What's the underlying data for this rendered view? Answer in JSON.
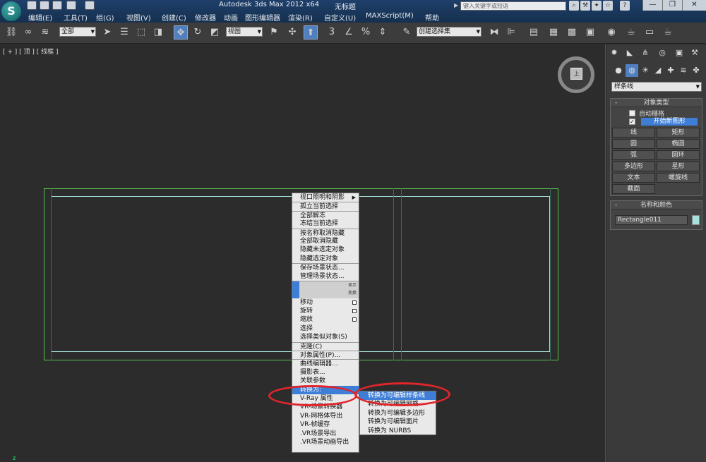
{
  "titlebar": {
    "window_title": "Autodesk 3ds Max  2012 x64",
    "doc_title": "无标题",
    "search_placeholder": "键入关键字或短语"
  },
  "menu": [
    "编辑(E)",
    "工具(T)",
    "组(G)",
    "视图(V)",
    "创建(C)",
    "修改器",
    "动画",
    "图形编辑器",
    "渲染(R)",
    "自定义(U)",
    "MAXScript(M)",
    "帮助"
  ],
  "toolbar": {
    "selection_filter": "全部",
    "ref_coord": "视图",
    "named_selection": "创建选择集"
  },
  "viewport": {
    "label": "[ + ] [ 顶 ] [ 线框 ]",
    "viewcube_face": "上",
    "corner_mark": "z"
  },
  "quad_menu": {
    "left_items": [
      "视口照明和阴影",
      "孤立当前选择",
      "全部解冻",
      "冻结当前选择",
      "按名称取消隐藏",
      "全部取消隐藏",
      "隐藏未选定对象",
      "隐藏选定对象",
      "保存场景状态...",
      "管理场景状态...",
      "显示",
      "变换",
      "移动",
      "旋转",
      "缩放",
      "选择",
      "选择类似对象(S)",
      "克隆(C)",
      "对象属性(P)...",
      "曲线编辑器...",
      "摄影表...",
      "关联参数",
      "转换为:",
      "V-Ray 属性",
      "VR-场景转换器",
      "VR-网格体导出",
      "VR-帧缓存",
      ".VR场景导出",
      ".VR场景动画导出"
    ],
    "submenu_items": [
      "转换为可编辑样条线",
      "转换为可编辑网格",
      "转换为可编辑多边形",
      "转换为可编辑面片",
      "转换为 NURBS"
    ]
  },
  "command_panel": {
    "category": "样条线",
    "object_type": {
      "header": "对象类型",
      "autogrid": "自动栅格",
      "start_new_shape": "开始新图形",
      "buttons": [
        "线",
        "矩形",
        "圆",
        "椭圆",
        "弧",
        "圆环",
        "多边形",
        "星形",
        "文本",
        "螺旋线",
        "截面"
      ]
    },
    "name_color": {
      "header": "名称和颜色",
      "object_name": "Rectangle011",
      "color": "#a6e3dc"
    }
  },
  "colors": {
    "highlight": "#3f7ed6",
    "annotation_red": "#e0252b",
    "shape_green": "#59c14f",
    "shape_cyan": "#a6e3dc"
  }
}
